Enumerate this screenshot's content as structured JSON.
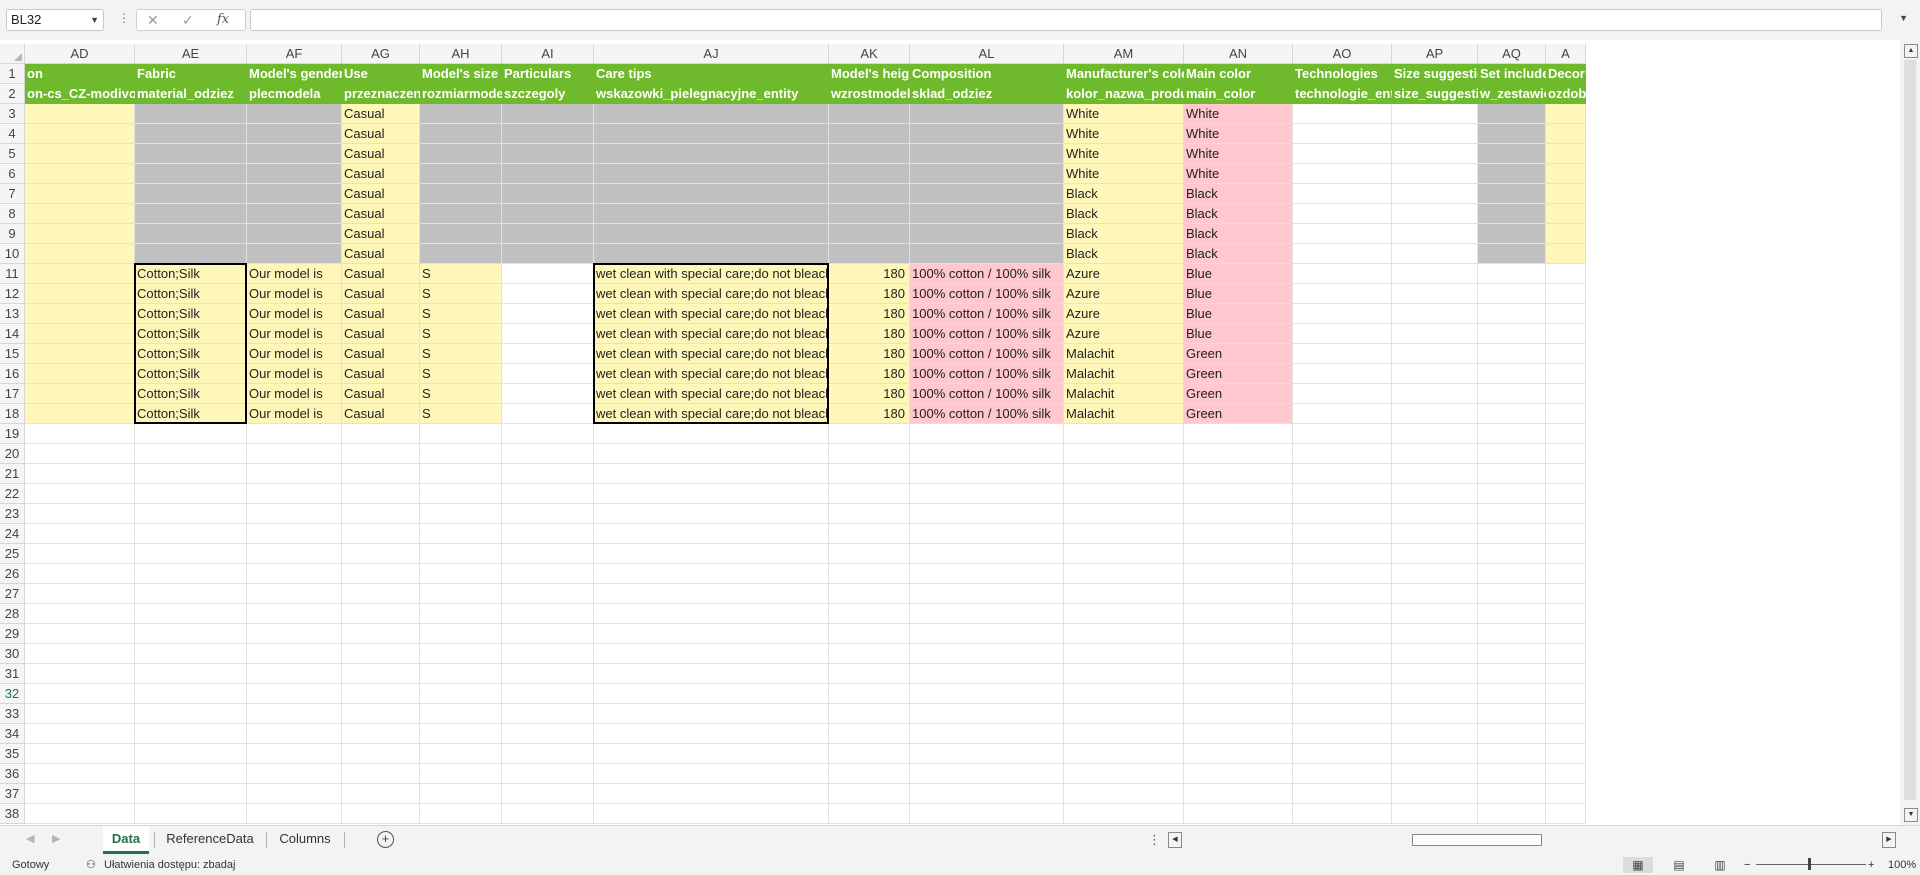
{
  "formula_bar": {
    "name_box": "BL32",
    "cancel_icon": "✕",
    "enter_icon": "✓",
    "fx_label": "fx",
    "formula": ""
  },
  "columns": [
    "AD",
    "AE",
    "AF",
    "AG",
    "AH",
    "AI",
    "AJ",
    "AK",
    "AL",
    "AM",
    "AN",
    "AO",
    "AP",
    "AQ",
    "A"
  ],
  "row_numbers": [
    "1",
    "2",
    "3",
    "4",
    "5",
    "6",
    "7",
    "8",
    "9",
    "10",
    "11",
    "12",
    "13",
    "14",
    "15",
    "16",
    "17",
    "18",
    "19",
    "20",
    "21",
    "22",
    "23",
    "24",
    "25",
    "26",
    "27",
    "28",
    "29",
    "30",
    "31",
    "32",
    "33",
    "34",
    "35",
    "36",
    "37",
    "38"
  ],
  "header_row_1": [
    "on",
    "Fabric",
    "Model's gender",
    "Use",
    "Model's size",
    "Particulars",
    "Care tips",
    "Model's height",
    "Composition",
    "",
    "Manufacturer's color",
    "Main color",
    "Technologies",
    "Size suggestion",
    "Set includes",
    "Decor"
  ],
  "header_row_2": [
    "on-cs_CZ-modivo",
    "material_odziez",
    "plecmodela",
    "przeznaczenie",
    "rozmiarmodela",
    "szczegoly",
    "wskazowki_pielegnacyjne_entity",
    "wzrostmodela",
    "sklad_odziez",
    "",
    "kolor_nazwa_produktu",
    "main_color",
    "technologie_entity",
    "size_suggestion",
    "w_zestawie",
    "ozdob"
  ],
  "header_labels": {
    "AD": [
      "on",
      "on-cs_CZ-modivo"
    ],
    "AE": [
      "Fabric",
      "material_odziez"
    ],
    "AF": [
      "Model's gender",
      "plecmodela"
    ],
    "AG": [
      "Use",
      "przeznaczenie"
    ],
    "AH": [
      "Model's size",
      "rozmiarmodela"
    ],
    "AI": [
      "Particulars",
      "szczegoly"
    ],
    "AJ": [
      "Care tips",
      "wskazowki_pielegnacyjne_entity"
    ],
    "AK": [
      "Model's height",
      "wzrostmodela"
    ],
    "AL": [
      "Composition",
      "sklad_odziez"
    ],
    "AM": [
      "Manufacturer's color",
      "kolor_nazwa_produktu"
    ],
    "AN": [
      "Main color",
      "main_color"
    ],
    "AO": [
      "Technologies",
      "technologie_entity"
    ],
    "AP": [
      "Size suggestion",
      "size_suggestion"
    ],
    "AQ": [
      "Set includes",
      "w_zestawie"
    ],
    "AR": [
      "Decor",
      "ozdob"
    ]
  },
  "rows": [
    {
      "AG": "Casual",
      "AM": "White",
      "AN": "White"
    },
    {
      "AG": "Casual",
      "AM": "White",
      "AN": "White"
    },
    {
      "AG": "Casual",
      "AM": "White",
      "AN": "White"
    },
    {
      "AG": "Casual",
      "AM": "White",
      "AN": "White"
    },
    {
      "AG": "Casual",
      "AM": "Black",
      "AN": "Black"
    },
    {
      "AG": "Casual",
      "AM": "Black",
      "AN": "Black"
    },
    {
      "AG": "Casual",
      "AM": "Black",
      "AN": "Black"
    },
    {
      "AG": "Casual",
      "AM": "Black",
      "AN": "Black"
    },
    {
      "AE": "Cotton;Silk",
      "AF": "Our model is",
      "AG": "Casual",
      "AH": "S",
      "AJ": "wet clean with special care;do not bleach",
      "AK": "180",
      "AL": "100% cotton / 100% silk",
      "AM": "Azure",
      "AN": "Blue"
    },
    {
      "AE": "Cotton;Silk",
      "AF": "Our model is",
      "AG": "Casual",
      "AH": "S",
      "AJ": "wet clean with special care;do not bleach",
      "AK": "180",
      "AL": "100% cotton / 100% silk",
      "AM": "Azure",
      "AN": "Blue"
    },
    {
      "AE": "Cotton;Silk",
      "AF": "Our model is",
      "AG": "Casual",
      "AH": "S",
      "AJ": "wet clean with special care;do not bleach",
      "AK": "180",
      "AL": "100% cotton / 100% silk",
      "AM": "Azure",
      "AN": "Blue"
    },
    {
      "AE": "Cotton;Silk",
      "AF": "Our model is",
      "AG": "Casual",
      "AH": "S",
      "AJ": "wet clean with special care;do not bleach",
      "AK": "180",
      "AL": "100% cotton / 100% silk",
      "AM": "Azure",
      "AN": "Blue"
    },
    {
      "AE": "Cotton;Silk",
      "AF": "Our model is",
      "AG": "Casual",
      "AH": "S",
      "AJ": "wet clean with special care;do not bleach",
      "AK": "180",
      "AL": "100% cotton / 100% silk",
      "AM": "Malachit",
      "AN": "Green"
    },
    {
      "AE": "Cotton;Silk",
      "AF": "Our model is",
      "AG": "Casual",
      "AH": "S",
      "AJ": "wet clean with special care;do not bleach",
      "AK": "180",
      "AL": "100% cotton / 100% silk",
      "AM": "Malachit",
      "AN": "Green"
    },
    {
      "AE": "Cotton;Silk",
      "AF": "Our model is",
      "AG": "Casual",
      "AH": "S",
      "AJ": "wet clean with special care;do not bleach",
      "AK": "180",
      "AL": "100% cotton / 100% silk",
      "AM": "Malachit",
      "AN": "Green"
    },
    {
      "AE": "Cotton;Silk",
      "AF": "Our model is",
      "AG": "Casual",
      "AH": "S",
      "AJ": "wet clean with special care;do not bleach",
      "AK": "180",
      "AL": "100% cotton / 100% silk",
      "AM": "Malachit",
      "AN": "Green"
    }
  ],
  "colors": {
    "header_green": "#6fba2c",
    "yellow_fill": "#fff6b9",
    "gray_fill": "#c0c0c0",
    "pink_fill": "#ffc7ce",
    "accent": "#217346"
  },
  "sheet_tabs": [
    "Data",
    "ReferenceData",
    "Columns"
  ],
  "active_sheet": "Data",
  "status": {
    "ready": "Gotowy",
    "accessibility": "Ułatwienia dostępu: zbadaj",
    "zoom": "100%"
  },
  "icons": {
    "accessibility": "accessibility-icon",
    "add_sheet": "plus-circle-icon",
    "normal_view": "grid-view-icon",
    "page_layout": "page-layout-icon",
    "page_break": "page-break-preview-icon"
  }
}
